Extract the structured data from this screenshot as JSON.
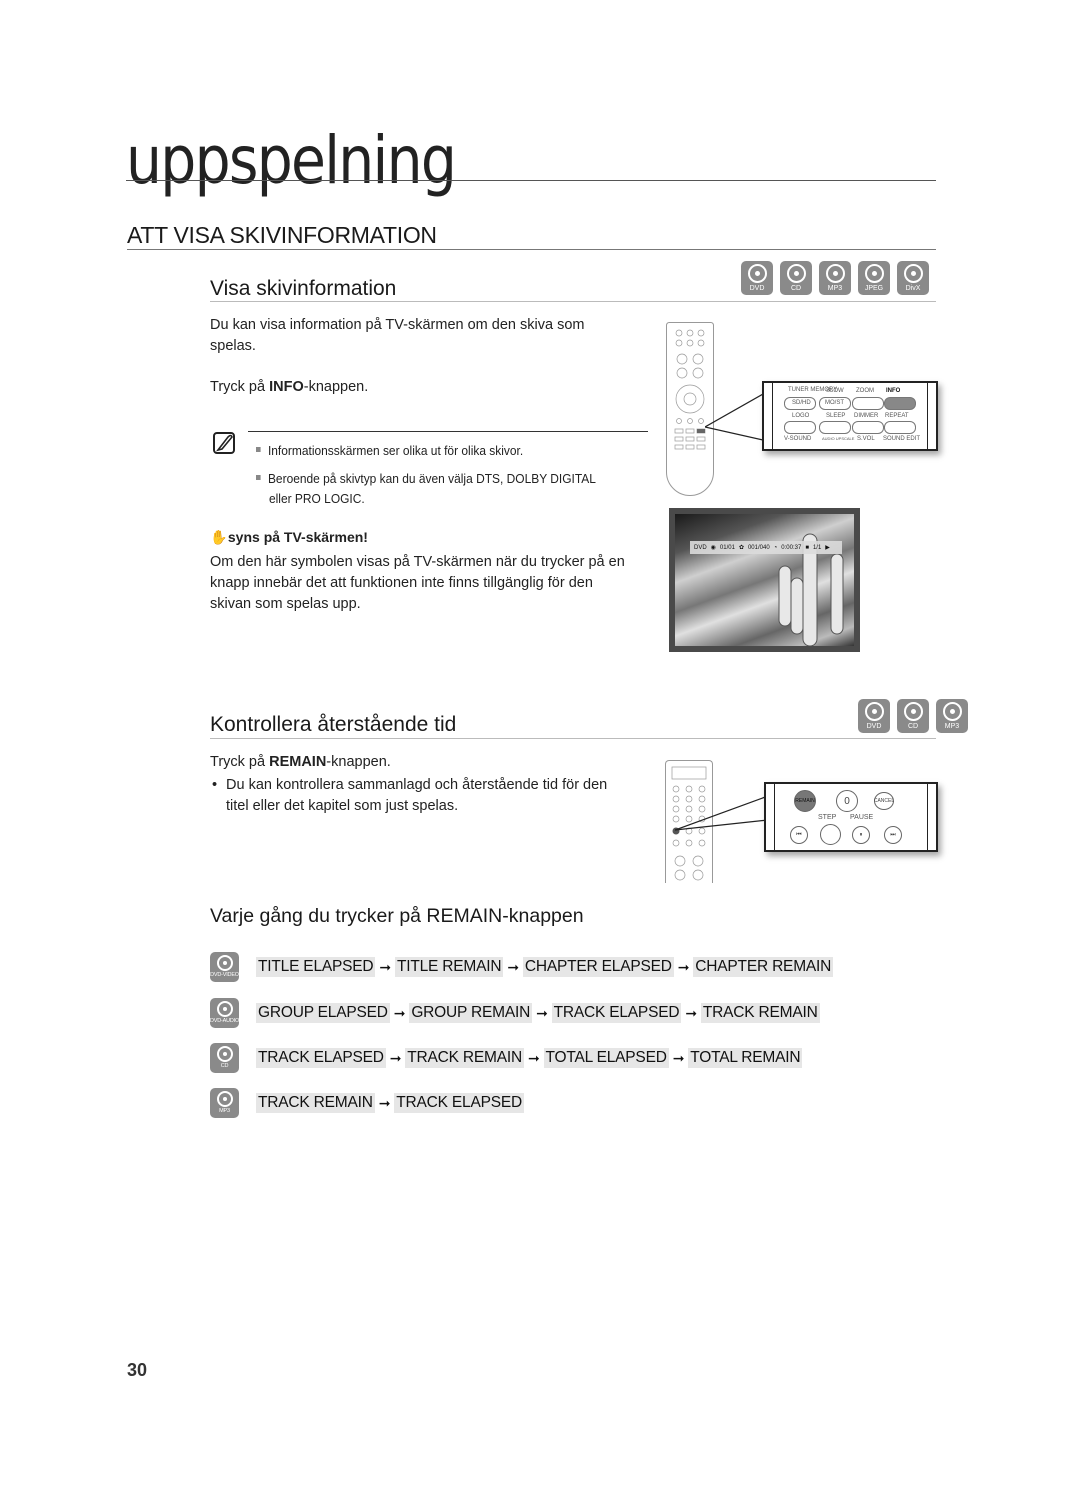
{
  "chapter": {
    "title": "uppspelning"
  },
  "section": {
    "title": "ATT VISA SKIVINFORMATION"
  },
  "disc_info": {
    "title": "Visa skivinformation",
    "discs": [
      "DVD",
      "CD",
      "MP3",
      "JPEG",
      "DivX"
    ],
    "intro": "Du kan visa information på TV-skärmen om den skiva som spelas.",
    "instruction_prefix": "Tryck på ",
    "instruction_key": "INFO",
    "instruction_suffix": "-knappen.",
    "notes": [
      "Informationsskärmen ser olika ut för olika skivor.",
      "Beroende på skivtyp kan du även välja DTS, DOLBY DIGITAL",
      "eller PRO LOGIC."
    ],
    "warning_title": "syns på TV-skärmen!",
    "warning_text": "Om den här symbolen visas på TV-skärmen när du trycker på en knapp innebär det att funktionen inte finns tillgänglig för den skivan som spelas upp.",
    "remote_buttons": {
      "row1": [
        "TUNER MEMORY",
        "SLOW",
        "ZOOM",
        "INFO"
      ],
      "row1_sub": [
        "SD/HD",
        "MO/ST",
        "",
        ""
      ],
      "row2": [
        "LOGO",
        "SLEEP",
        "DIMMER",
        "REPEAT"
      ],
      "row3": [
        "V-SOUND",
        "AUDIO UPSCALE",
        "S.VOL",
        "SOUND EDIT"
      ]
    },
    "osd": {
      "disc": "DVD",
      "title": "01/01",
      "chapter": "001/040",
      "time": "0:00:37",
      "angle": "1/1"
    }
  },
  "remaining_time": {
    "title": "Kontrollera återstående tid",
    "discs": [
      "DVD",
      "CD",
      "MP3"
    ],
    "instruction_prefix": "Tryck på ",
    "instruction_key": "REMAIN",
    "instruction_suffix": "-knappen.",
    "bullet": "Du kan kontrollera sammanlagd och återstående tid för den titel eller det kapitel som just spelas.",
    "remote_buttons": {
      "remain": "REMAIN",
      "zero": "0",
      "cancel": "CANCEL",
      "step": "STEP",
      "pause": "PAUSE"
    }
  },
  "cycle": {
    "title": "Varje gång du trycker på REMAIN-knappen",
    "arrow": "➞",
    "rows": [
      {
        "disc": "DVD-VIDEO",
        "states": [
          "TITLE ELAPSED",
          "TITLE REMAIN",
          "CHAPTER ELAPSED",
          "CHAPTER REMAIN"
        ]
      },
      {
        "disc": "DVD-AUDIO",
        "states": [
          "GROUP ELAPSED",
          "GROUP REMAIN",
          "TRACK ELAPSED",
          "TRACK REMAIN"
        ]
      },
      {
        "disc": "CD",
        "states": [
          "TRACK ELAPSED",
          "TRACK REMAIN",
          "TOTAL ELAPSED",
          "TOTAL REMAIN"
        ]
      },
      {
        "disc": "MP3",
        "states": [
          "TRACK REMAIN",
          "TRACK ELAPSED"
        ]
      }
    ]
  },
  "page_number": "30"
}
